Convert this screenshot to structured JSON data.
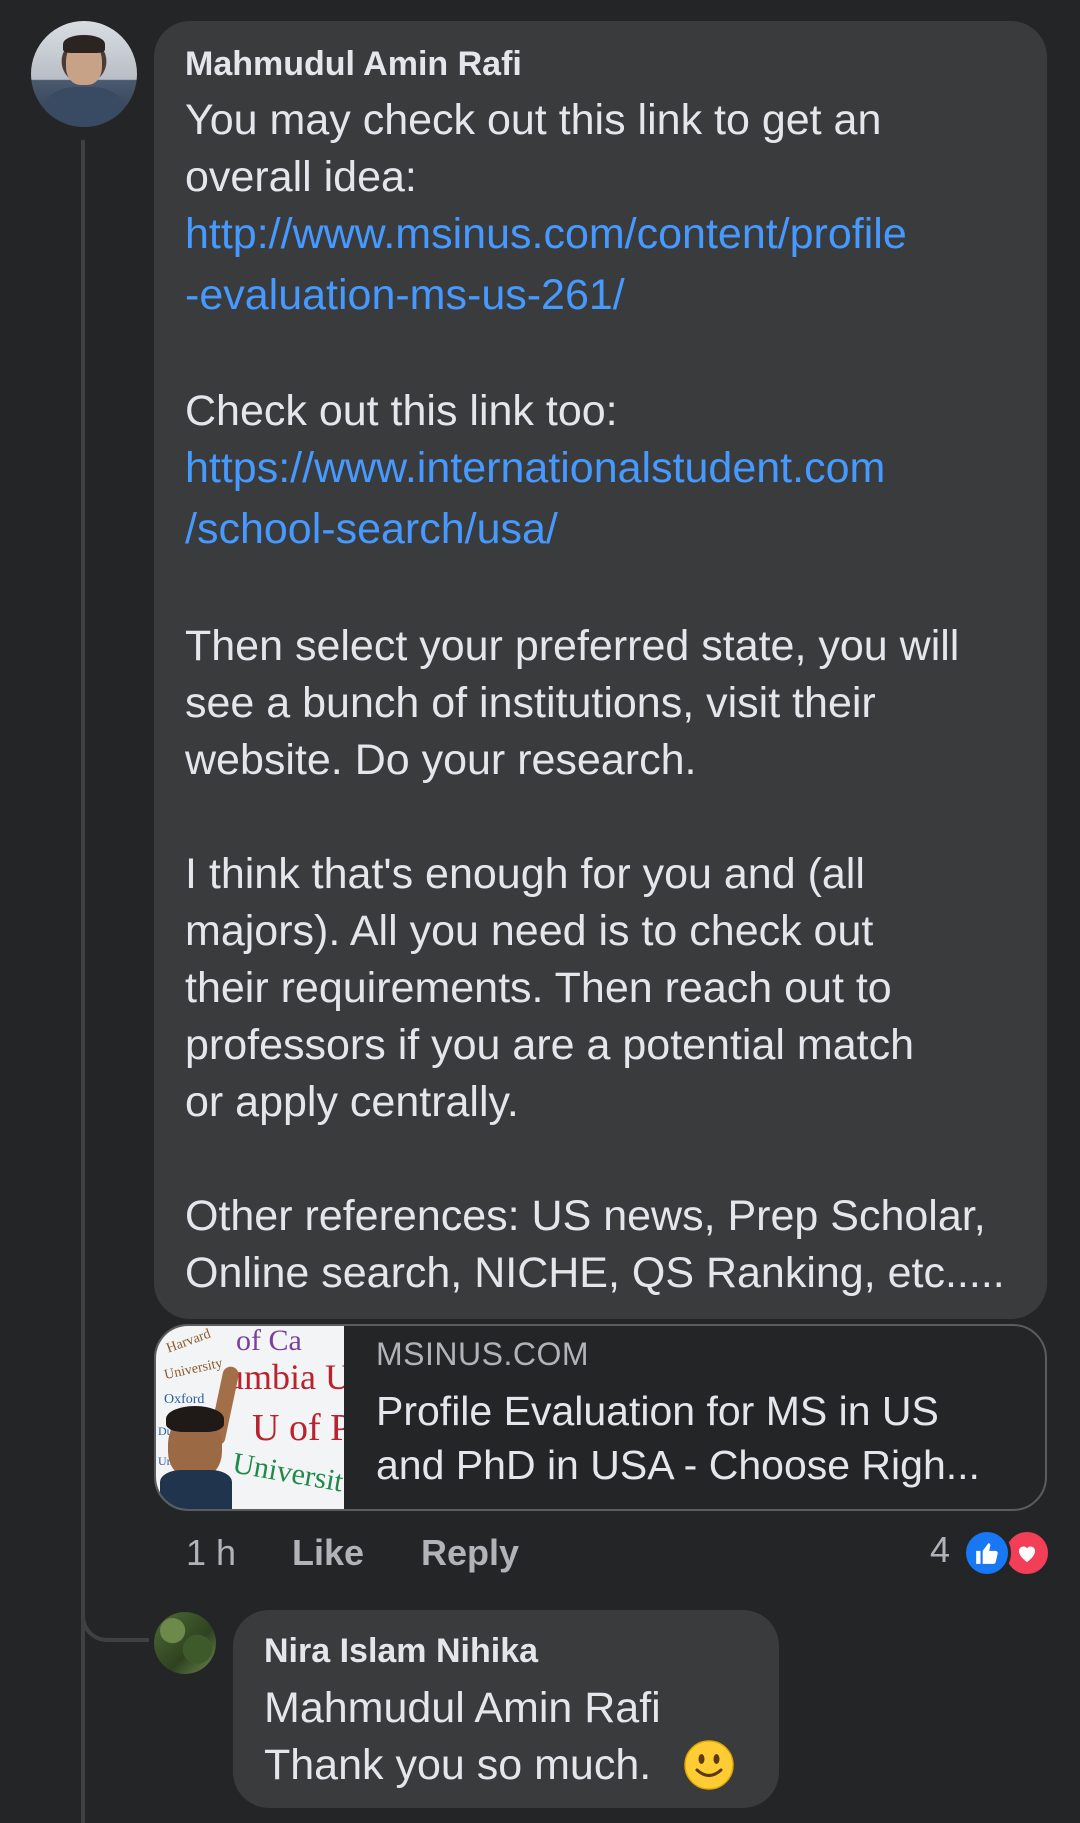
{
  "comment": {
    "author": "Mahmudul Amin Rafi",
    "lines": [
      "You may check out this link to get an",
      "overall idea:",
      "http://www.msinus.com/content/profile",
      "-evaluation-ms-us-261/",
      "Check out this link too:",
      "https://www.internationalstudent.com",
      "/school-search/usa/",
      "Then select your preferred state, you will",
      "see a bunch of institutions, visit their",
      "website. Do your research.",
      "I think that's enough for you and (all",
      "majors). All you need is to check out",
      "their requirements. Then reach out to",
      "professors if you are a potential match",
      "or apply centrally.",
      "Other references: US news, Prep Scholar,",
      "Online search, NICHE, QS Ranking, etc....."
    ],
    "link_color": "#4599ff"
  },
  "preview": {
    "domain": "MSINUS.COM",
    "title_lines": [
      "Profile Evaluation for MS in US",
      "and PhD in USA - Choose Righ..."
    ],
    "thumbnail_text": [
      "Harvard",
      "University",
      "of Ca",
      "Oxford",
      "umbia Un",
      "U of Pe",
      "Universit",
      "Dul",
      "Uni"
    ]
  },
  "actions": {
    "time": "1 h",
    "like": "Like",
    "reply": "Reply",
    "reaction_count": "4",
    "reactions": [
      "like-icon",
      "love-icon"
    ]
  },
  "reply": {
    "author": "Nira Islam Nihika",
    "mention": "Mahmudul Amin Rafi",
    "text": "Thank you so much.",
    "emoji": "slightly-smiling-face-icon"
  }
}
